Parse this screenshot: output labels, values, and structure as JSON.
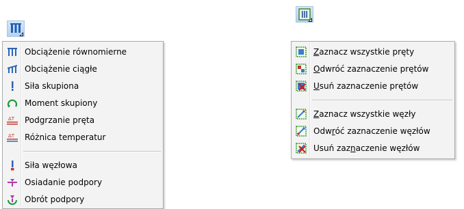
{
  "left_menu": {
    "button_icon": "load-group-icon",
    "items": [
      {
        "label": "Obciążenie równomierne",
        "icon": "uniform-load-icon"
      },
      {
        "label": "Obciążenie ciągłe",
        "icon": "continuous-load-icon"
      },
      {
        "label": "Siła skupiona",
        "icon": "point-force-icon"
      },
      {
        "label": "Moment skupiony",
        "icon": "point-moment-icon"
      },
      {
        "label": "Podgrzanie pręta",
        "icon": "bar-heating-icon"
      },
      {
        "label": "Różnica temperatur",
        "icon": "temperature-difference-icon"
      },
      {
        "label": "Siła węzłowa",
        "icon": "nodal-force-icon"
      },
      {
        "label": "Osiadanie podpory",
        "icon": "support-settlement-icon"
      },
      {
        "label": "Obrót podpory",
        "icon": "support-rotation-icon"
      }
    ]
  },
  "right_menu": {
    "button_icon": "selection-group-icon",
    "items": [
      {
        "pre": "",
        "key": "Z",
        "post": "aznacz wszystkie pręty",
        "icon": "select-all-bars-icon"
      },
      {
        "pre": "",
        "key": "O",
        "post": "dwróć zaznaczenie prętów",
        "icon": "invert-bars-selection-icon"
      },
      {
        "pre": "",
        "key": "U",
        "post": "suń zaznaczenie prętów",
        "icon": "remove-bars-selection-icon"
      },
      {
        "pre": "",
        "key": "Z",
        "post": "aznacz wszystkie węzły",
        "icon": "select-all-nodes-icon"
      },
      {
        "pre": "Odw",
        "key": "r",
        "post": "óć zaznaczenie węzłów",
        "icon": "invert-nodes-selection-icon"
      },
      {
        "pre": "Usuń zaz",
        "key": "n",
        "post": "aczenie węzłów",
        "icon": "remove-nodes-selection-icon"
      }
    ]
  }
}
